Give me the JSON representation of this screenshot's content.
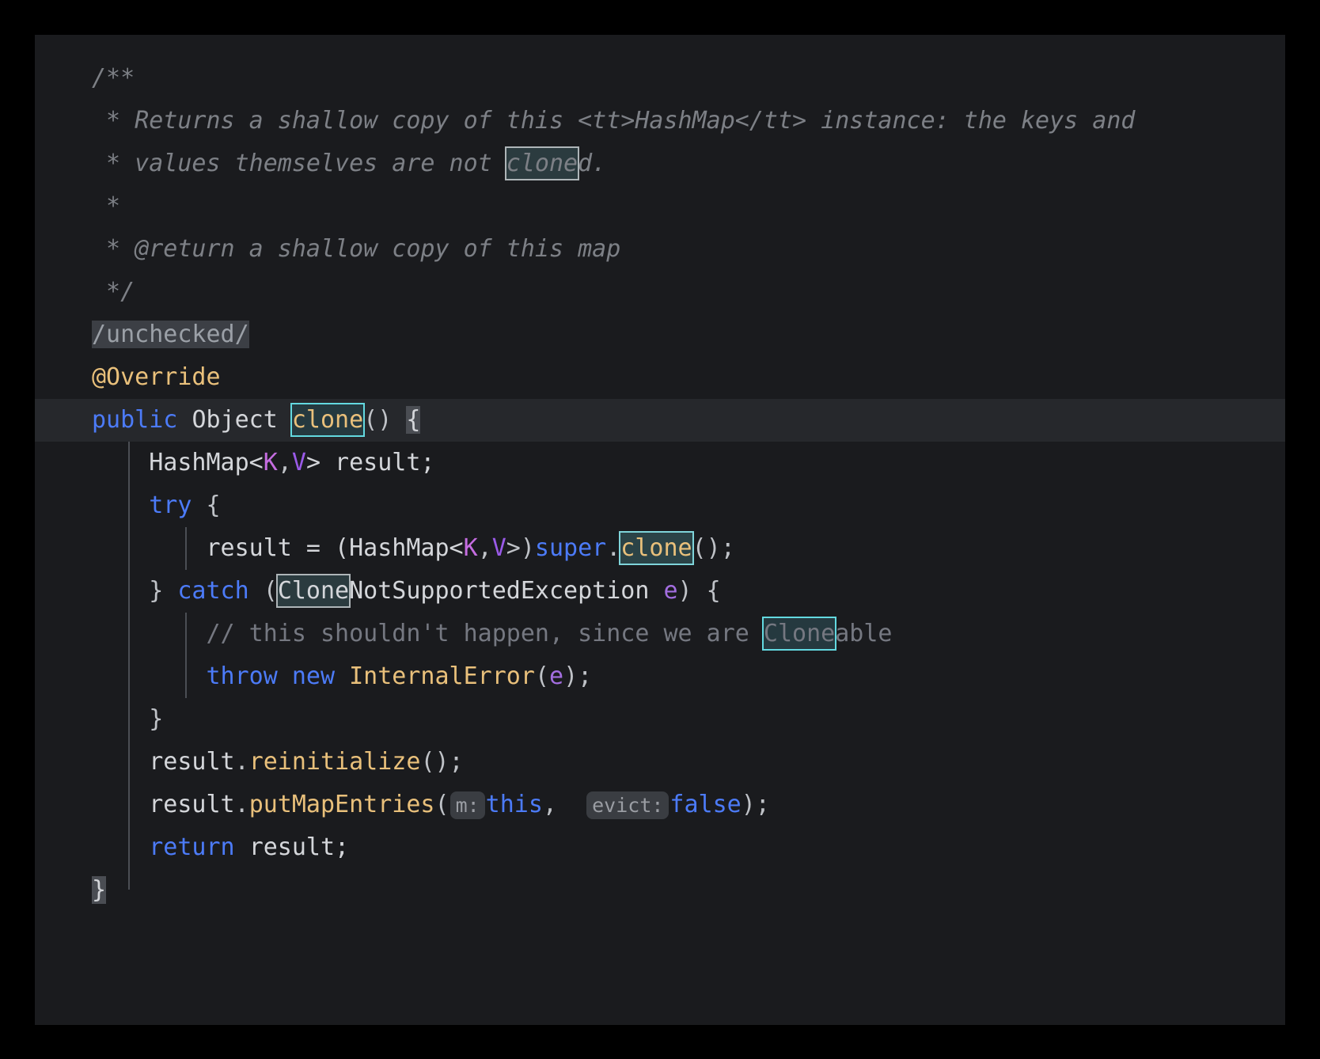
{
  "editor": {
    "theme": "dark",
    "language": "java",
    "background": "#1a1b1e",
    "current_line_background": "#26282c",
    "outer_background": "#000000",
    "search_highlight_color": "#63d9e0",
    "search_highlight_fill": "#25393f",
    "caret_word_highlight": "#3c3f45",
    "colors": {
      "keyword": "#4c7bf8",
      "identifier": "#d4d6da",
      "method": "#e9c07b",
      "annotation": "#e9c07b",
      "javadoc": "#7d8086",
      "line_comment": "#757881",
      "type_param_k": "#c56de0",
      "type_param_v": "#9a5ae8",
      "parameter": "#a36ee0",
      "punctuation": "#bfc2c7",
      "hint_background": "#3a3d42",
      "hint_text": "#9a9da3"
    }
  },
  "code": {
    "lines": [
      {
        "id": "l1",
        "text": "/**"
      },
      {
        "id": "l2",
        "text": " * Returns a shallow copy of this <tt>HashMap</tt> instance: the keys and"
      },
      {
        "id": "l3",
        "text": " * values themselves are not cloned."
      },
      {
        "id": "l4",
        "text": " *"
      },
      {
        "id": "l5",
        "text": " * @return a shallow copy of this map"
      },
      {
        "id": "l6",
        "text": " */"
      },
      {
        "id": "l7",
        "text": "/unchecked/"
      },
      {
        "id": "l8",
        "text": "@Override"
      },
      {
        "id": "l9",
        "text": "public Object clone() {"
      },
      {
        "id": "l10",
        "text": "    HashMap<K,V> result;"
      },
      {
        "id": "l11",
        "text": "    try {"
      },
      {
        "id": "l12",
        "text": "        result = (HashMap<K,V>)super.clone();"
      },
      {
        "id": "l13",
        "text": "    } catch (CloneNotSupportedException e) {"
      },
      {
        "id": "l14",
        "text": "        // this shouldn't happen, since we are Cloneable"
      },
      {
        "id": "l15",
        "text": "        throw new InternalError(e);"
      },
      {
        "id": "l16",
        "text": "    }"
      },
      {
        "id": "l17",
        "text": "    result.reinitialize();"
      },
      {
        "id": "l18",
        "text": "    result.putMapEntries( m: this,  evict: false);"
      },
      {
        "id": "l19",
        "text": "    return result;"
      },
      {
        "id": "l20",
        "text": "}"
      }
    ],
    "tokens": {
      "jdoc_open": "/**",
      "jdoc_l2": " * Returns a shallow copy of this <tt>HashMap</tt> instance: the keys and",
      "jdoc_l3_pre": " * values themselves are not ",
      "jdoc_l3_match": "clone",
      "jdoc_l3_post": "d.",
      "jdoc_l4": " *",
      "jdoc_l5": " * @return a shallow copy of this map",
      "jdoc_close": " */",
      "unchecked": "/unchecked/",
      "override": "@Override",
      "kw_public": "public",
      "type_object": "Object",
      "method_clone": "clone",
      "parens_empty": "()",
      "brace_open": "{",
      "type_hashmap": "HashMap<",
      "gen_k": "K",
      "comma": ",",
      "gen_v": "V",
      "gt_result": "> result;",
      "kw_try": "try",
      "stmt_result_eq": "result = (HashMap<",
      "cast_close": ">)",
      "kw_super": "super",
      "dot": ".",
      "call_close": "();",
      "brace_close": "}",
      "kw_catch": "catch",
      "paren_open": "(",
      "exc_match": "Clone",
      "exc_rest": "NotSupportedException ",
      "param_e": "e",
      "paren_close_brace": ") {",
      "comment_pre": "// this shouldn't happen, since we are ",
      "comment_match": "Clone",
      "comment_post": "able",
      "kw_throw": "throw",
      "kw_new": "new",
      "type_internalerror": "InternalError",
      "semi_close": ");",
      "ident_result": "result",
      "method_reinitialize": "reinitialize",
      "method_putmapentries": "putMapEntries",
      "hint_m": "m:",
      "kw_this": "this",
      "comma_sp": ",",
      "hint_evict": "evict:",
      "kw_false": "false",
      "kw_return": "return",
      "ident_result_semi": "result;"
    }
  }
}
